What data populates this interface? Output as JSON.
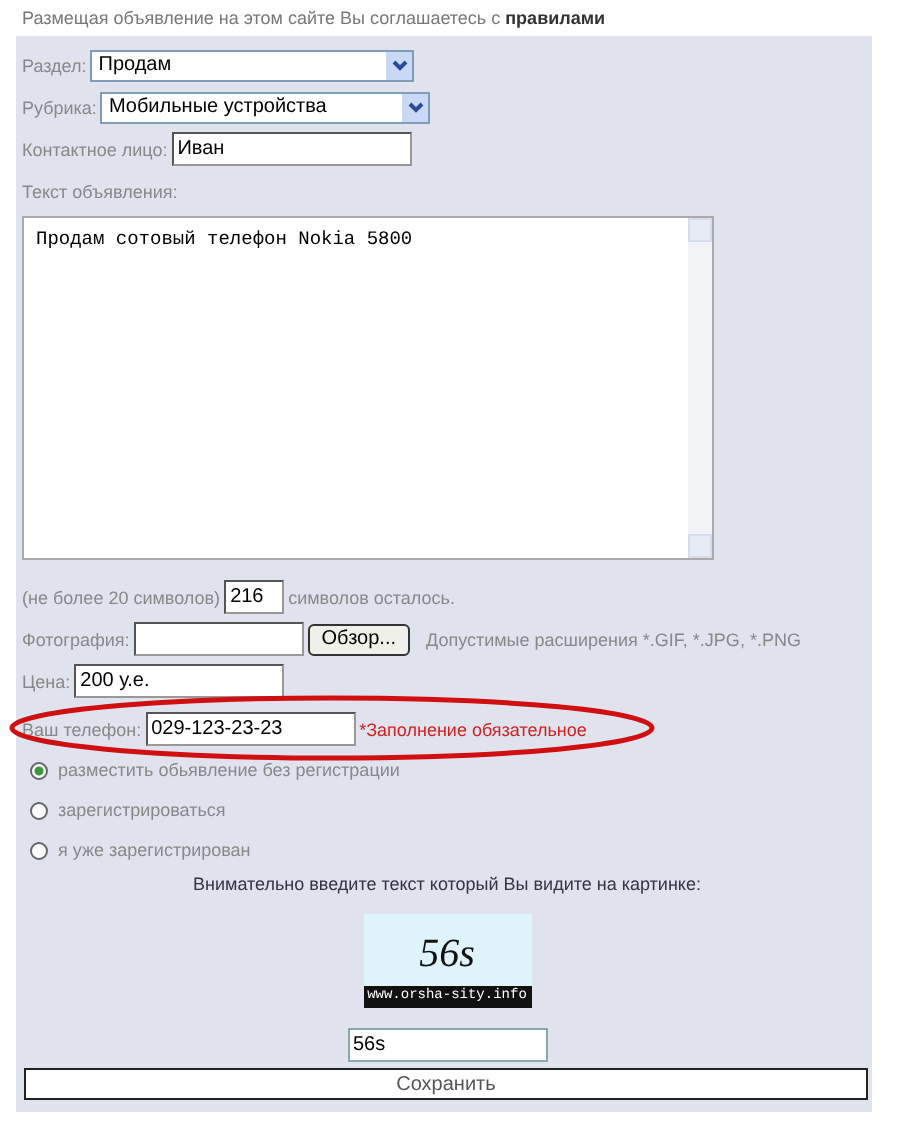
{
  "notice": "Размещая объявление на этом сайте Вы соглашаетесь с **правилами**",
  "section": {
    "label": "Раздел:",
    "value": "Продам"
  },
  "category": {
    "label": "Рубрика:",
    "value": "Мобильные устройства"
  },
  "contact": {
    "label": "Контактное лицо:",
    "value": "Иван"
  },
  "ad_text": {
    "label": "Текст объявления:",
    "value": "Продам сотовый телефон Nokia 5800"
  },
  "counter": {
    "prefix": "(не более 20 символов)",
    "value": "216",
    "suffix": "символов осталось."
  },
  "photo": {
    "label": "Фотография:",
    "button": "Обзор...",
    "hint": "Допустимые расширения *.GIF, *.JPG, *.PNG"
  },
  "price": {
    "label": "Цена:",
    "value": "200 у.е."
  },
  "phone": {
    "label": "Ваш телефон:",
    "value": "029-123-23-23",
    "required": "*Заполнение обязательное",
    "highlighted": true
  },
  "options": [
    {
      "label": "разместить обьявление без регистрации",
      "selected": true
    },
    {
      "label": "зарегистрироваться",
      "selected": false
    },
    {
      "label": "я уже зарегистрирован",
      "selected": false
    }
  ],
  "captcha": {
    "prompt": "Внимательно введите текст который Вы видите на картинке:",
    "code": "56s",
    "caption": "www.orsha-sity.info",
    "value": "56s"
  },
  "save_button": "Сохранить"
}
